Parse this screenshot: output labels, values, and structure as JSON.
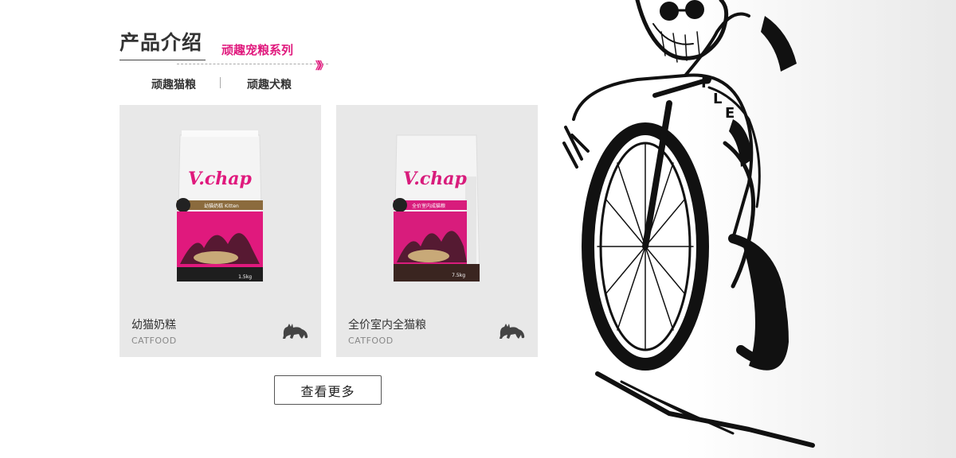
{
  "section": {
    "title": "产品介绍",
    "subtitle": "顽趣宠粮系列",
    "arrows": "》》"
  },
  "tabs": [
    {
      "label": "顽趣猫粮"
    },
    {
      "label": "顽趣犬粮"
    }
  ],
  "products": [
    {
      "name": "幼猫奶糕",
      "category": "CATFOOD",
      "brand": "V.chap",
      "band_text": "幼猫奶糕 Kitten",
      "weight": "1.5kg",
      "bag_color": "#e0197d",
      "icon": "cat-icon"
    },
    {
      "name": "全价室内全猫粮",
      "category": "CATFOOD",
      "brand": "V.chap",
      "band_text": "全价室内成猫粮",
      "weight": "7.5kg",
      "bag_color": "#d81c7c",
      "icon": "cat-icon"
    }
  ],
  "more_button": {
    "label": "查看更多"
  },
  "colors": {
    "accent": "#e0197d",
    "card_bg": "#e8e8e8"
  }
}
